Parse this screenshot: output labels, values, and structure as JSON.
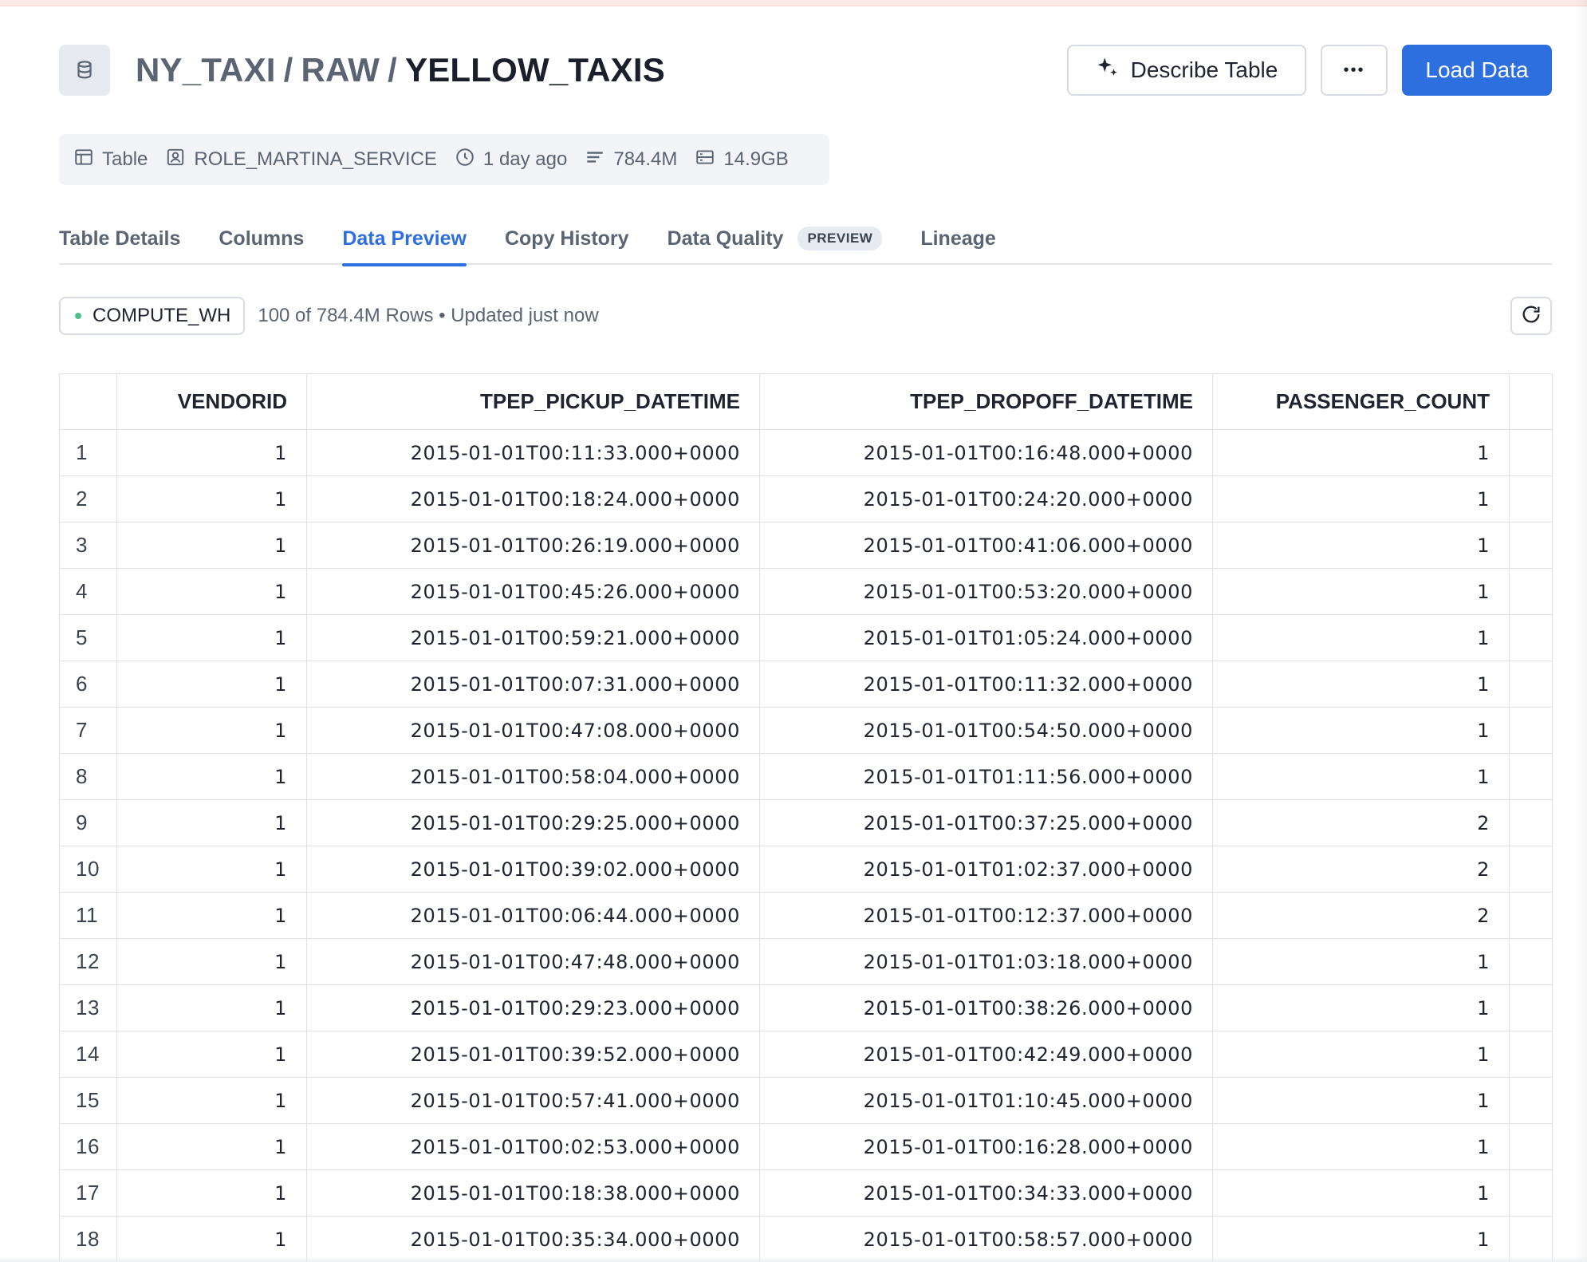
{
  "header": {
    "title_segments": [
      "NY_TAXI",
      "RAW",
      "YELLOW_TAXIS"
    ],
    "title_separator": "/",
    "describe_label": "Describe Table",
    "more_label": "•••",
    "load_label": "Load Data"
  },
  "meta": {
    "type": "Table",
    "owner": "ROLE_MARTINA_SERVICE",
    "updated": "1 day ago",
    "rows": "784.4M",
    "size": "14.9GB"
  },
  "tabs": [
    {
      "label": "Table Details"
    },
    {
      "label": "Columns"
    },
    {
      "label": "Data Preview",
      "active": true
    },
    {
      "label": "Copy History"
    },
    {
      "label": "Data Quality",
      "badge": "PREVIEW"
    },
    {
      "label": "Lineage"
    }
  ],
  "toolbar": {
    "warehouse": "COMPUTE_WH",
    "row_info": "100 of 784.4M Rows • Updated just now"
  },
  "table": {
    "columns": [
      "",
      "VENDORID",
      "TPEP_PICKUP_DATETIME",
      "TPEP_DROPOFF_DATETIME",
      "PASSENGER_COUNT",
      ""
    ],
    "rows": [
      [
        "1",
        "1",
        "2015-01-01T00:11:33.000+0000",
        "2015-01-01T00:16:48.000+0000",
        "1"
      ],
      [
        "2",
        "1",
        "2015-01-01T00:18:24.000+0000",
        "2015-01-01T00:24:20.000+0000",
        "1"
      ],
      [
        "3",
        "1",
        "2015-01-01T00:26:19.000+0000",
        "2015-01-01T00:41:06.000+0000",
        "1"
      ],
      [
        "4",
        "1",
        "2015-01-01T00:45:26.000+0000",
        "2015-01-01T00:53:20.000+0000",
        "1"
      ],
      [
        "5",
        "1",
        "2015-01-01T00:59:21.000+0000",
        "2015-01-01T01:05:24.000+0000",
        "1"
      ],
      [
        "6",
        "1",
        "2015-01-01T00:07:31.000+0000",
        "2015-01-01T00:11:32.000+0000",
        "1"
      ],
      [
        "7",
        "1",
        "2015-01-01T00:47:08.000+0000",
        "2015-01-01T00:54:50.000+0000",
        "1"
      ],
      [
        "8",
        "1",
        "2015-01-01T00:58:04.000+0000",
        "2015-01-01T01:11:56.000+0000",
        "1"
      ],
      [
        "9",
        "1",
        "2015-01-01T00:29:25.000+0000",
        "2015-01-01T00:37:25.000+0000",
        "2"
      ],
      [
        "10",
        "1",
        "2015-01-01T00:39:02.000+0000",
        "2015-01-01T01:02:37.000+0000",
        "2"
      ],
      [
        "11",
        "1",
        "2015-01-01T00:06:44.000+0000",
        "2015-01-01T00:12:37.000+0000",
        "2"
      ],
      [
        "12",
        "1",
        "2015-01-01T00:47:48.000+0000",
        "2015-01-01T01:03:18.000+0000",
        "1"
      ],
      [
        "13",
        "1",
        "2015-01-01T00:29:23.000+0000",
        "2015-01-01T00:38:26.000+0000",
        "1"
      ],
      [
        "14",
        "1",
        "2015-01-01T00:39:52.000+0000",
        "2015-01-01T00:42:49.000+0000",
        "1"
      ],
      [
        "15",
        "1",
        "2015-01-01T00:57:41.000+0000",
        "2015-01-01T01:10:45.000+0000",
        "1"
      ],
      [
        "16",
        "1",
        "2015-01-01T00:02:53.000+0000",
        "2015-01-01T00:16:28.000+0000",
        "1"
      ],
      [
        "17",
        "1",
        "2015-01-01T00:18:38.000+0000",
        "2015-01-01T00:34:33.000+0000",
        "1"
      ],
      [
        "18",
        "1",
        "2015-01-01T00:35:34.000+0000",
        "2015-01-01T00:58:57.000+0000",
        "1"
      ]
    ]
  }
}
